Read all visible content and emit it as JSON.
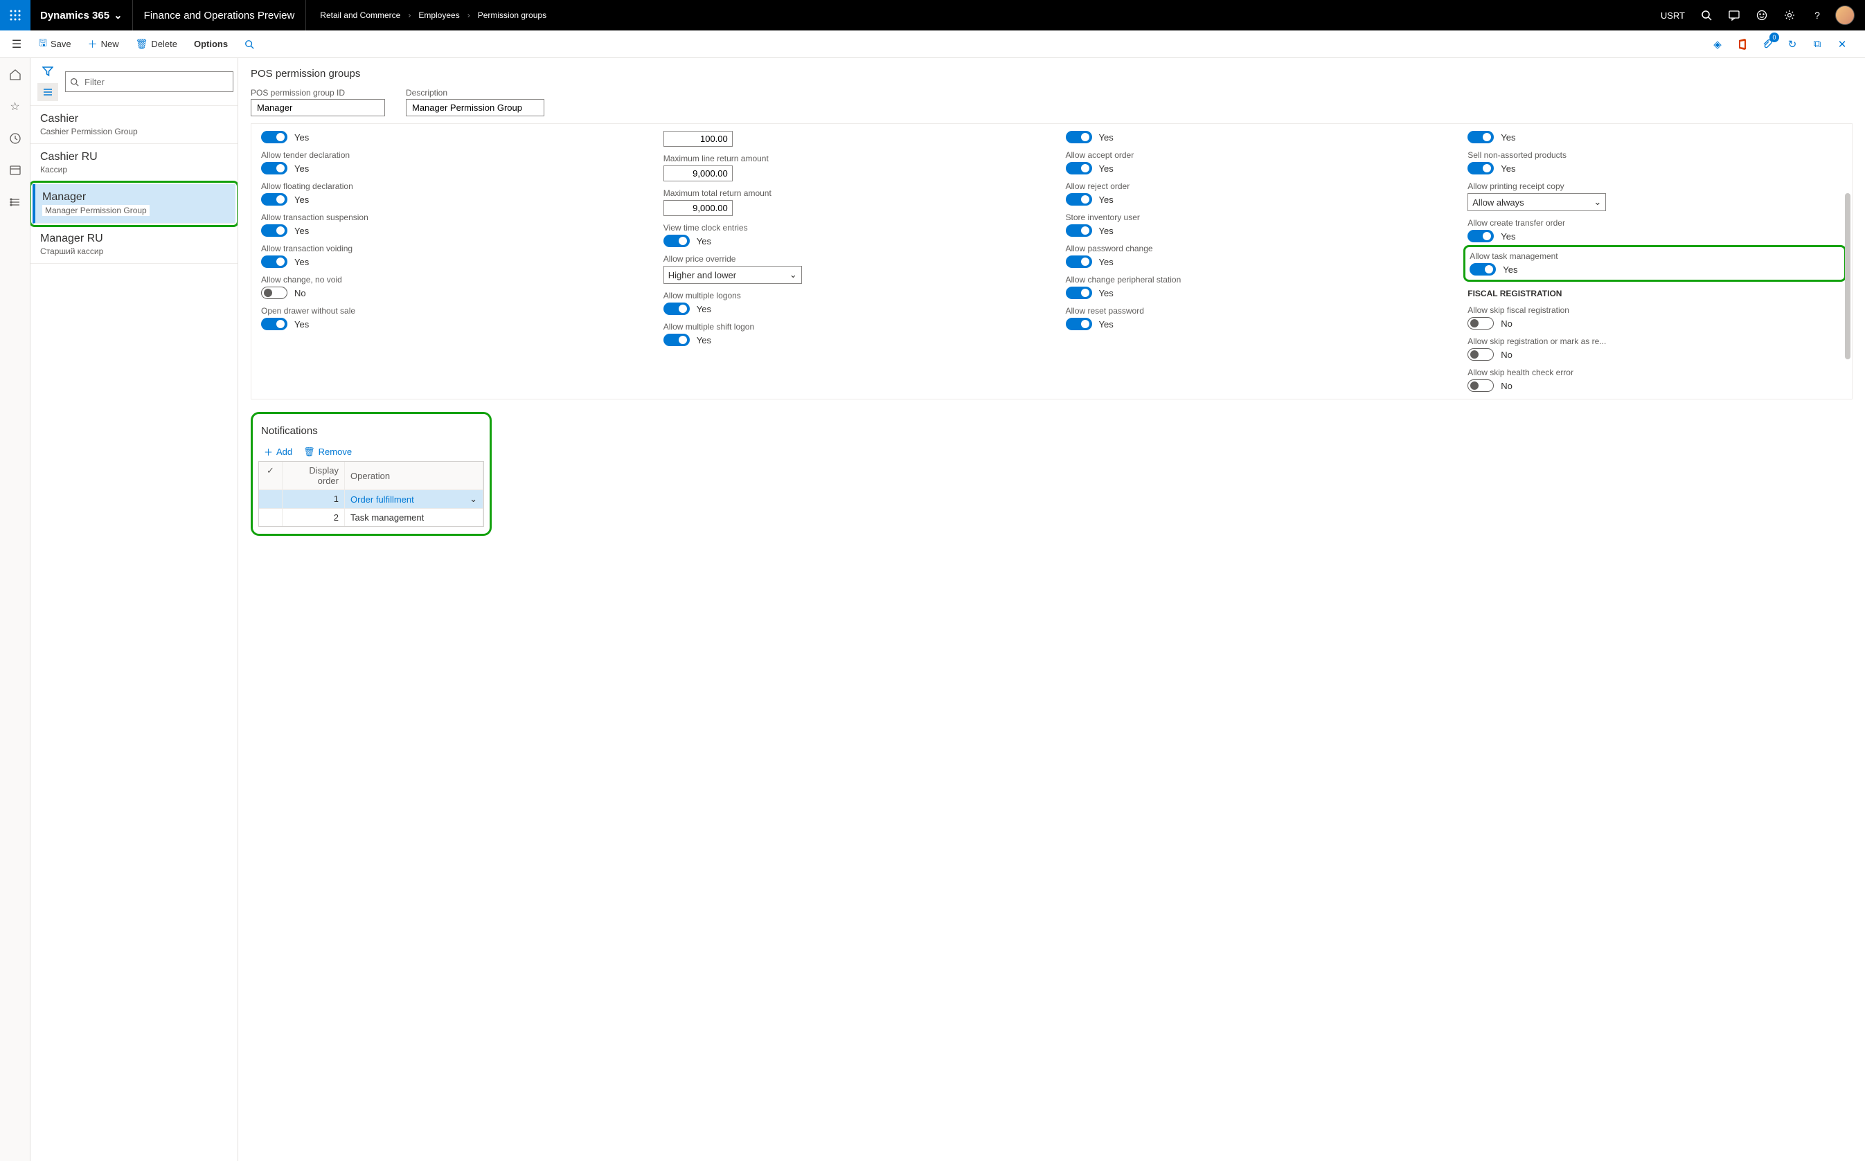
{
  "topbar": {
    "brand": "Dynamics 365",
    "preview": "Finance and Operations Preview",
    "crumbs": [
      "Retail and Commerce",
      "Employees",
      "Permission groups"
    ],
    "company": "USRT",
    "notif_badge": "0"
  },
  "actionbar": {
    "save": "Save",
    "new": "New",
    "delete": "Delete",
    "options": "Options"
  },
  "filter_placeholder": "Filter",
  "list": [
    {
      "title": "Cashier",
      "desc": "Cashier Permission Group",
      "selected": false
    },
    {
      "title": "Cashier RU",
      "desc": "Кассир",
      "selected": false
    },
    {
      "title": "Manager",
      "desc": "Manager Permission Group",
      "selected": true
    },
    {
      "title": "Manager RU",
      "desc": "Старший кассир",
      "selected": false
    }
  ],
  "detail_title": "POS permission groups",
  "header_fields": {
    "id_label": "POS permission group ID",
    "id_value": "Manager",
    "desc_label": "Description",
    "desc_value": "Manager Permission Group"
  },
  "col1": {
    "f0": {
      "value": "Yes"
    },
    "f1": {
      "label": "Allow tender declaration",
      "value": "Yes"
    },
    "f2": {
      "label": "Allow floating declaration",
      "value": "Yes"
    },
    "f3": {
      "label": "Allow transaction suspension",
      "value": "Yes"
    },
    "f4": {
      "label": "Allow transaction voiding",
      "value": "Yes"
    },
    "f5": {
      "label": "Allow change, no void",
      "value": "No"
    },
    "f6": {
      "label": "Open drawer without sale",
      "value": "Yes"
    }
  },
  "col2": {
    "f0": {
      "value": "100.00"
    },
    "f1": {
      "label": "Maximum line return amount",
      "value": "9,000.00"
    },
    "f2": {
      "label": "Maximum total return amount",
      "value": "9,000.00"
    },
    "f3": {
      "label": "View time clock entries",
      "value": "Yes"
    },
    "f4": {
      "label": "Allow price override",
      "value": "Higher and lower"
    },
    "f5": {
      "label": "Allow multiple logons",
      "value": "Yes"
    },
    "f6": {
      "label": "Allow multiple shift logon",
      "value": "Yes"
    }
  },
  "col3": {
    "f0": {
      "value": "Yes"
    },
    "f1": {
      "label": "Allow accept order",
      "value": "Yes"
    },
    "f2": {
      "label": "Allow reject order",
      "value": "Yes"
    },
    "f3": {
      "label": "Store inventory user",
      "value": "Yes"
    },
    "f4": {
      "label": "Allow password change",
      "value": "Yes"
    },
    "f5": {
      "label": "Allow change peripheral station",
      "value": "Yes"
    },
    "f6": {
      "label": "Allow reset password",
      "value": "Yes"
    }
  },
  "col4": {
    "f0": {
      "value": "Yes"
    },
    "f1": {
      "label": "Sell non-assorted products",
      "value": "Yes"
    },
    "f2": {
      "label": "Allow printing receipt copy",
      "value": "Allow always"
    },
    "f3": {
      "label": "Allow create transfer order",
      "value": "Yes"
    },
    "f4": {
      "label": "Allow task management",
      "value": "Yes"
    },
    "section": "FISCAL REGISTRATION",
    "f5": {
      "label": "Allow skip fiscal registration",
      "value": "No"
    },
    "f6": {
      "label": "Allow skip registration or mark as re...",
      "value": "No"
    },
    "f7": {
      "label": "Allow skip health check error",
      "value": "No"
    }
  },
  "notifications": {
    "title": "Notifications",
    "add": "Add",
    "remove": "Remove",
    "headers": {
      "order": "Display order",
      "op": "Operation"
    },
    "rows": [
      {
        "order": "1",
        "op": "Order fulfillment",
        "selected": true
      },
      {
        "order": "2",
        "op": "Task management",
        "selected": false
      }
    ]
  }
}
